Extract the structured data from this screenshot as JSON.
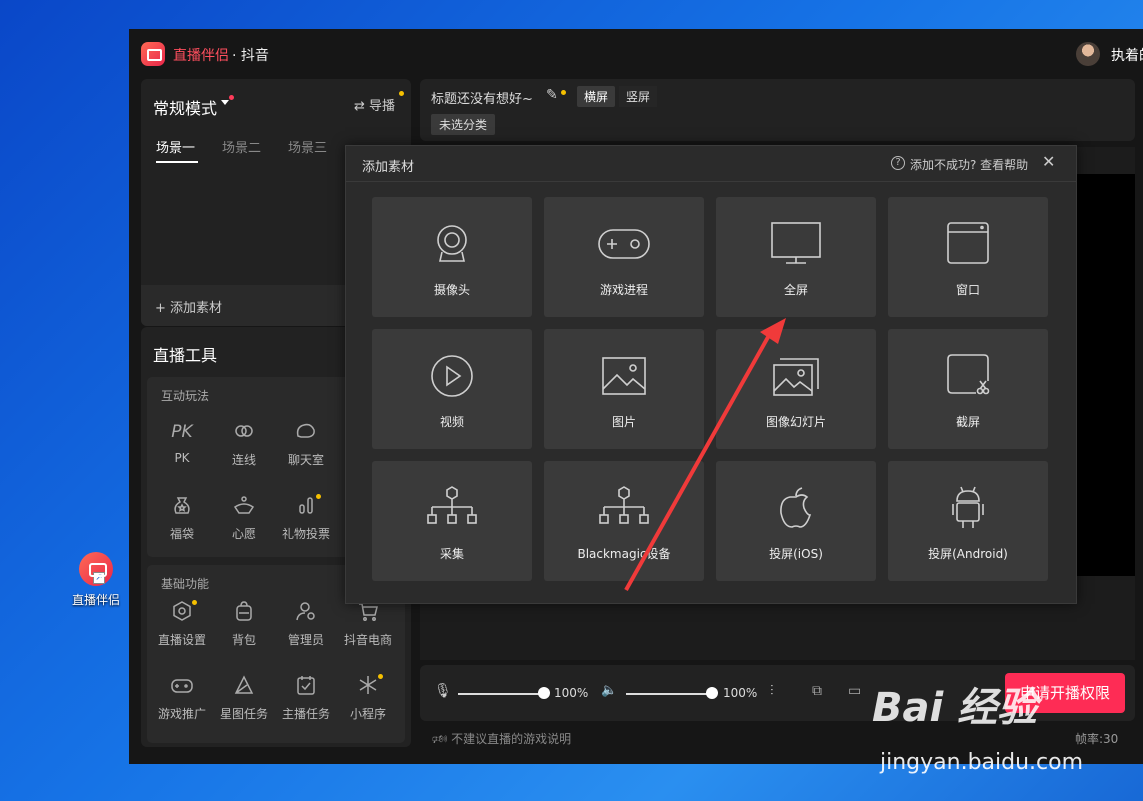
{
  "desktop": {
    "icon_label": "直播伴侣"
  },
  "app": {
    "name": "直播伴侣",
    "platform": "· 抖音",
    "username": "执着的"
  },
  "scene_panel": {
    "mode": "常规模式",
    "guide": "⇄ 导播",
    "scenes": [
      "场景一",
      "场景二",
      "场景三"
    ],
    "add_material": "+ 添加素材"
  },
  "tools": {
    "title": "直播工具",
    "interactive_title": "互动玩法",
    "interactive": [
      {
        "label": "PK",
        "icon": "pk-icon"
      },
      {
        "label": "连线",
        "icon": "link-icon"
      },
      {
        "label": "聊天室",
        "icon": "chatroom-icon"
      },
      {
        "label": "福袋",
        "icon": "lucky-bag-icon"
      },
      {
        "label": "心愿",
        "icon": "wish-icon"
      },
      {
        "label": "礼物投票",
        "icon": "gift-vote-icon"
      }
    ],
    "basic_title": "基础功能",
    "basic": [
      {
        "label": "直播设置",
        "icon": "settings-icon"
      },
      {
        "label": "背包",
        "icon": "backpack-icon"
      },
      {
        "label": "管理员",
        "icon": "admin-icon"
      },
      {
        "label": "抖音电商",
        "icon": "cart-icon"
      },
      {
        "label": "游戏推广",
        "icon": "gamepad-icon"
      },
      {
        "label": "星图任务",
        "icon": "star-map-icon"
      },
      {
        "label": "主播任务",
        "icon": "task-icon"
      },
      {
        "label": "小程序",
        "icon": "mini-program-icon"
      }
    ]
  },
  "top_info": {
    "title": "标题还没有想好~",
    "orientation_h": "横屏",
    "orientation_v": "竖屏",
    "category": "未选分类"
  },
  "bottom": {
    "mic_volume": "100%",
    "speaker_volume": "100%",
    "apply_button": "申请开播权限",
    "warning": "不建议直播的游戏说明",
    "fps": "帧率:30"
  },
  "modal": {
    "title": "添加素材",
    "help": "添加不成功? 查看帮助",
    "tiles": [
      {
        "label": "摄像头",
        "icon": "camera-icon"
      },
      {
        "label": "游戏进程",
        "icon": "game-process-icon"
      },
      {
        "label": "全屏",
        "icon": "monitor-icon"
      },
      {
        "label": "窗口",
        "icon": "window-icon"
      },
      {
        "label": "视频",
        "icon": "video-icon"
      },
      {
        "label": "图片",
        "icon": "image-icon"
      },
      {
        "label": "图像幻灯片",
        "icon": "slideshow-icon"
      },
      {
        "label": "截屏",
        "icon": "screenshot-icon"
      },
      {
        "label": "采集",
        "icon": "capture-icon"
      },
      {
        "label": "Blackmagic设备",
        "icon": "blackmagic-icon"
      },
      {
        "label": "投屏(iOS)",
        "icon": "apple-icon"
      },
      {
        "label": "投屏(Android)",
        "icon": "android-icon"
      }
    ]
  },
  "watermark": {
    "brand": "Bai 经验",
    "url": "jingyan.baidu.com"
  },
  "colors": {
    "accent": "#fe2c55",
    "brand_red": "#ff4f5e",
    "badge": "#f5c000"
  }
}
